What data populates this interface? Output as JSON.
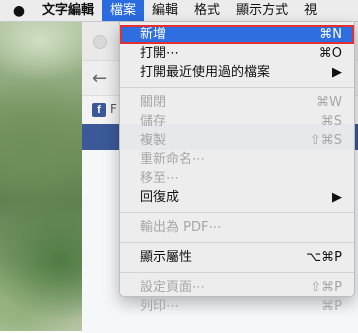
{
  "menubar": {
    "items": [
      {
        "label": "文字編輯"
      },
      {
        "label": "檔案"
      },
      {
        "label": "編輯"
      },
      {
        "label": "格式"
      },
      {
        "label": "顯示方式"
      },
      {
        "label": "視"
      }
    ]
  },
  "menu": {
    "items": [
      {
        "label": "新增",
        "shortcut": "⌘N"
      },
      {
        "label": "打開⋯",
        "shortcut": "⌘O"
      },
      {
        "label": "打開最近使用過的檔案",
        "shortcut": "▶"
      },
      {
        "label": "關閉",
        "shortcut": "⌘W"
      },
      {
        "label": "儲存",
        "shortcut": "⌘S"
      },
      {
        "label": "複製",
        "shortcut": "⇧⌘S"
      },
      {
        "label": "重新命名⋯",
        "shortcut": ""
      },
      {
        "label": "移至⋯",
        "shortcut": ""
      },
      {
        "label": "回復成",
        "shortcut": "▶"
      },
      {
        "label": "輸出為 PDF⋯",
        "shortcut": ""
      },
      {
        "label": "顯示屬性",
        "shortcut": "⌥⌘P"
      },
      {
        "label": "設定頁面⋯",
        "shortcut": "⇧⌘P"
      },
      {
        "label": "列印⋯",
        "shortcut": "⌘P"
      }
    ]
  },
  "window": {
    "fb_letter": "f",
    "fb_text": "F"
  },
  "colors": {
    "menu_highlight": "#2f6ee0",
    "highlight_outline": "#e03030",
    "active_menubar": "#2a6be0"
  }
}
